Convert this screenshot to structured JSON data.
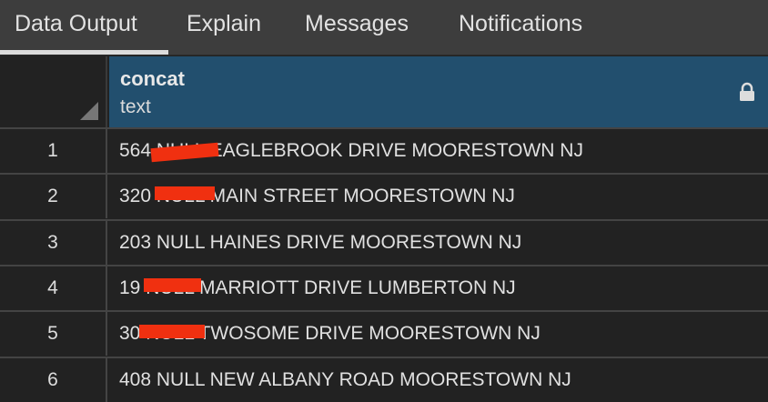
{
  "tabs": [
    {
      "label": "Data Output",
      "active": true
    },
    {
      "label": "Explain"
    },
    {
      "label": "Messages"
    },
    {
      "label": "Notifications"
    }
  ],
  "column": {
    "name": "concat",
    "type": "text",
    "icon": "lock-icon"
  },
  "rows": [
    {
      "n": "1",
      "value": "564 NULL EAGLEBROOK DRIVE MOORESTOWN NJ"
    },
    {
      "n": "2",
      "value": "320 NULL MAIN STREET MOORESTOWN NJ"
    },
    {
      "n": "3",
      "value": "203 NULL HAINES DRIVE MOORESTOWN NJ"
    },
    {
      "n": "4",
      "value": "19 NULL MARRIOTT DRIVE LUMBERTON NJ"
    },
    {
      "n": "5",
      "value": "30 NULL TWOSOME DRIVE MOORESTOWN NJ"
    },
    {
      "n": "6",
      "value": "408 NULL NEW ALBANY ROAD MOORESTOWN NJ"
    }
  ],
  "colors": {
    "header": "#224f6e",
    "redaction": "#f03010"
  }
}
